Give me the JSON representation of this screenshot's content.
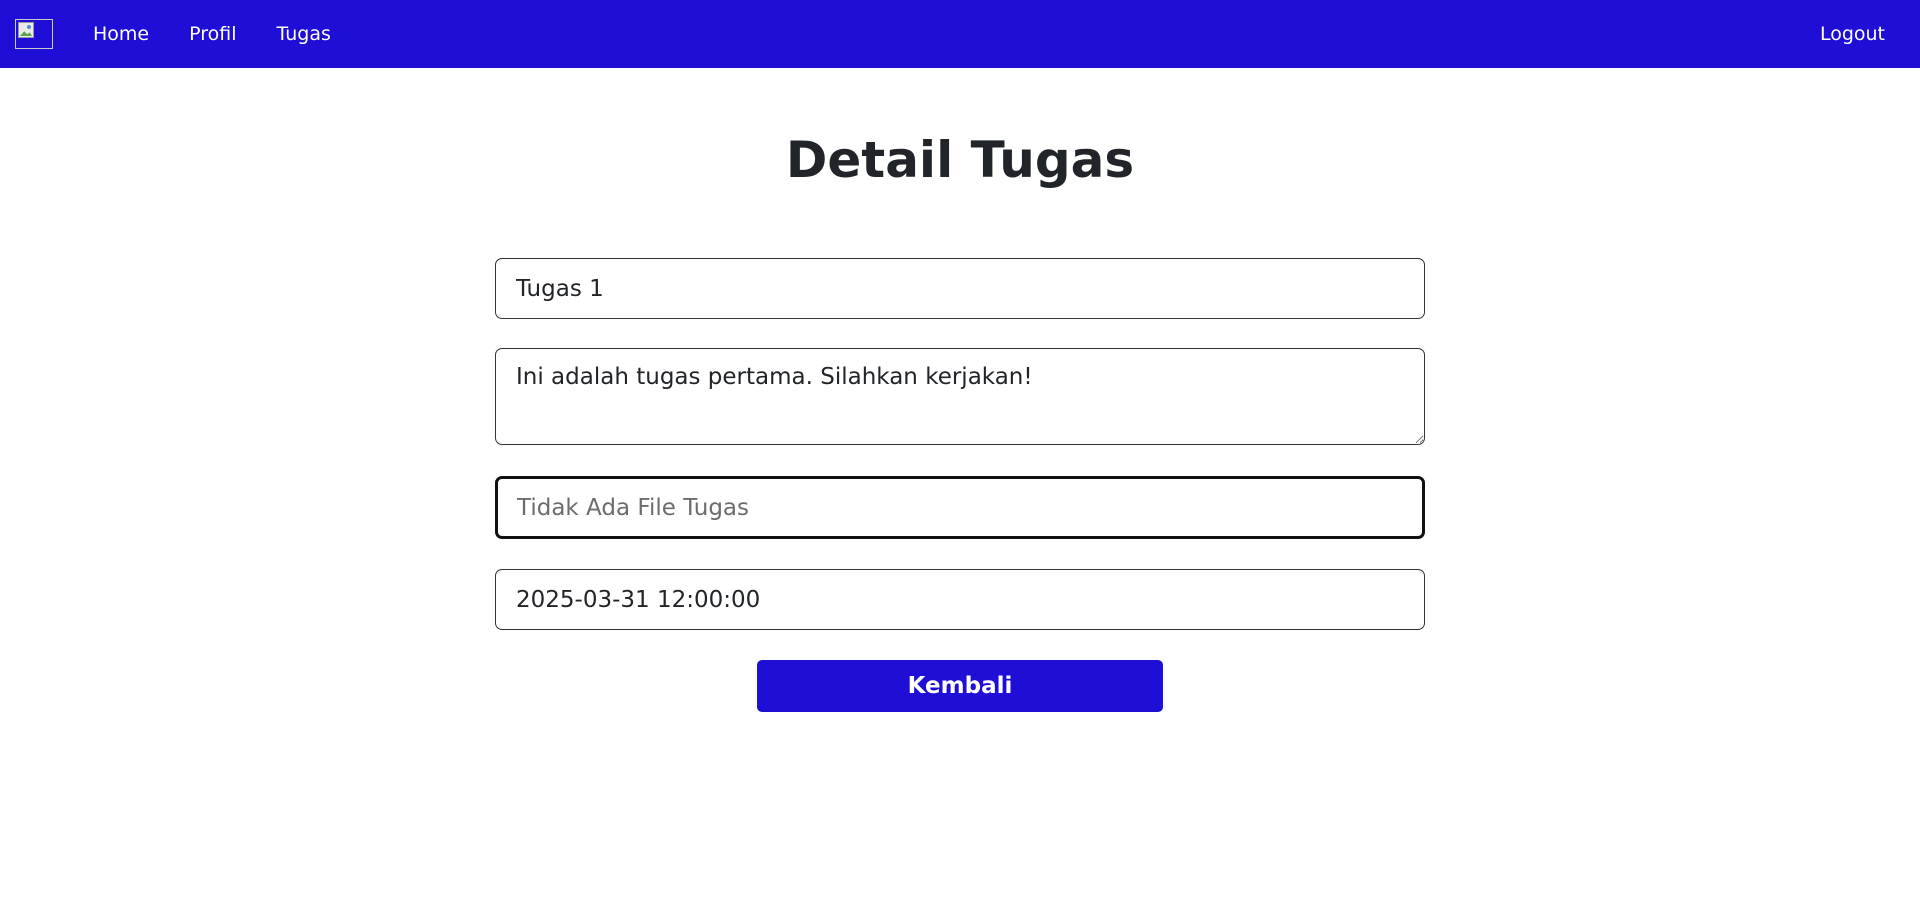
{
  "navbar": {
    "logo_icon": "broken-image-icon",
    "links": [
      {
        "label": "Home"
      },
      {
        "label": "Profil"
      },
      {
        "label": "Tugas"
      }
    ],
    "logout_label": "Logout",
    "background": "#1e0ed6"
  },
  "main": {
    "title": "Detail Tugas",
    "fields": {
      "title_value": "Tugas 1",
      "description_value": "Ini adalah tugas pertama. Silahkan kerjakan!",
      "file_placeholder": "Tidak Ada File Tugas",
      "deadline_value": "2025-03-31 12:00:00"
    },
    "back_button_label": "Kembali",
    "accent_color": "#1e0ed6"
  }
}
